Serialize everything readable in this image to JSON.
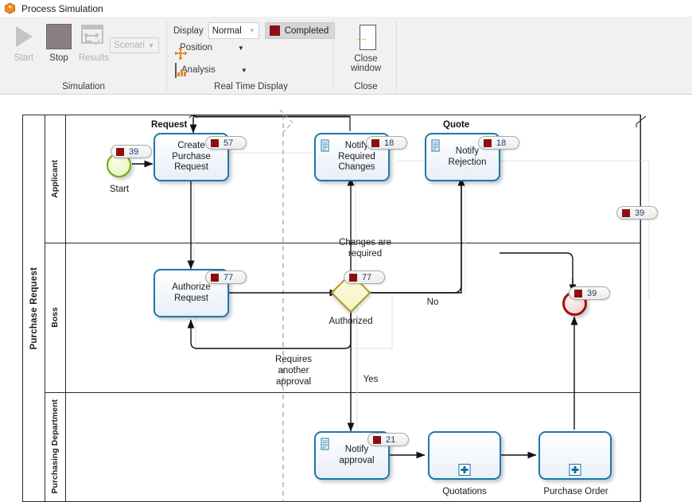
{
  "window": {
    "title": "Process Simulation",
    "icon": "app-hexagon-icon"
  },
  "ribbon": {
    "groups": [
      {
        "name": "Simulation",
        "title": "Simulation",
        "buttons": [
          {
            "label": "Start",
            "icon": "play-icon",
            "enabled": false
          },
          {
            "label": "Stop",
            "icon": "stop-icon",
            "enabled": true
          },
          {
            "label": "Results",
            "icon": "results-icon",
            "enabled": false
          }
        ],
        "scenario": {
          "value": "Scenari",
          "caret": "▼"
        }
      },
      {
        "name": "Real Time Display",
        "title": "Real Time Display",
        "display_label": "Display",
        "display_value": "Normal",
        "display_caret": "▼",
        "completed_label": "Completed",
        "completed_color": "#8b0f12",
        "menus": [
          {
            "label": "Position",
            "icon": "move-crosshair-icon",
            "caret": "▼"
          },
          {
            "label": "Analysis",
            "icon": "bar-chart-icon",
            "caret": "▼"
          }
        ]
      },
      {
        "name": "Close",
        "title": "Close",
        "close_label_line1": "Close",
        "close_label_line2": "window",
        "close_icon": "close-window-arrow-icon"
      }
    ]
  },
  "diagram": {
    "pool": {
      "label": "Purchase Request"
    },
    "lanes": [
      {
        "label": "Applicant"
      },
      {
        "label": "Boss"
      },
      {
        "label": "Purchasing Department"
      }
    ],
    "events": [
      {
        "id": "start",
        "type": "start",
        "caption": "Start",
        "badge": "39"
      },
      {
        "id": "end",
        "type": "end",
        "caption": "",
        "badge": "39"
      }
    ],
    "gateways": [
      {
        "id": "authorized",
        "caption": "Authorized",
        "badge": "77"
      }
    ],
    "tasks": [
      {
        "id": "create-purchase-request",
        "label": "Create\nPurchase\nRequest",
        "badge": "57",
        "icon": null
      },
      {
        "id": "notify-required-changes",
        "label": "Notify\nRequired\nChanges",
        "badge": "18",
        "icon": "document-icon"
      },
      {
        "id": "notify-rejection",
        "label": "Notify\nRejection",
        "badge": "18",
        "icon": "document-icon"
      },
      {
        "id": "authorize-request",
        "label": "Authorize\nRequest",
        "badge": "77",
        "icon": null
      },
      {
        "id": "notify-approval",
        "label": "Notify\napproval",
        "badge": "21",
        "icon": "document-icon"
      }
    ],
    "subprocesses": [
      {
        "id": "quotations",
        "caption": "Quotations",
        "marker": "plus-icon"
      },
      {
        "id": "purchase-order",
        "caption": "Purchase Order",
        "marker": "plus-icon"
      }
    ],
    "flow_labels": [
      {
        "id": "changes-required",
        "text": "Changes are\nrequired"
      },
      {
        "id": "no",
        "text": "No"
      },
      {
        "id": "yes",
        "text": "Yes"
      },
      {
        "id": "requires-another-approval",
        "text": "Requires\nanother\napproval"
      }
    ],
    "message_labels": [
      {
        "id": "request",
        "text": "Request"
      },
      {
        "id": "quote",
        "text": "Quote"
      }
    ],
    "top_badge": "39",
    "lines": {
      "task_line_1": "Create",
      "task_line_2": "Purchase",
      "task_line_3": "Request",
      "nrc_1": "Notify",
      "nrc_2": "Required",
      "nrc_3": "Changes",
      "nr_1": "Notify",
      "nr_2": "Rejection",
      "ar_1": "Authorize",
      "ar_2": "Request",
      "na_1": "Notify",
      "na_2": "approval",
      "cr_1": "Changes are",
      "cr_2": "required",
      "ra_1": "Requires",
      "ra_2": "another",
      "ra_3": "approval"
    }
  }
}
